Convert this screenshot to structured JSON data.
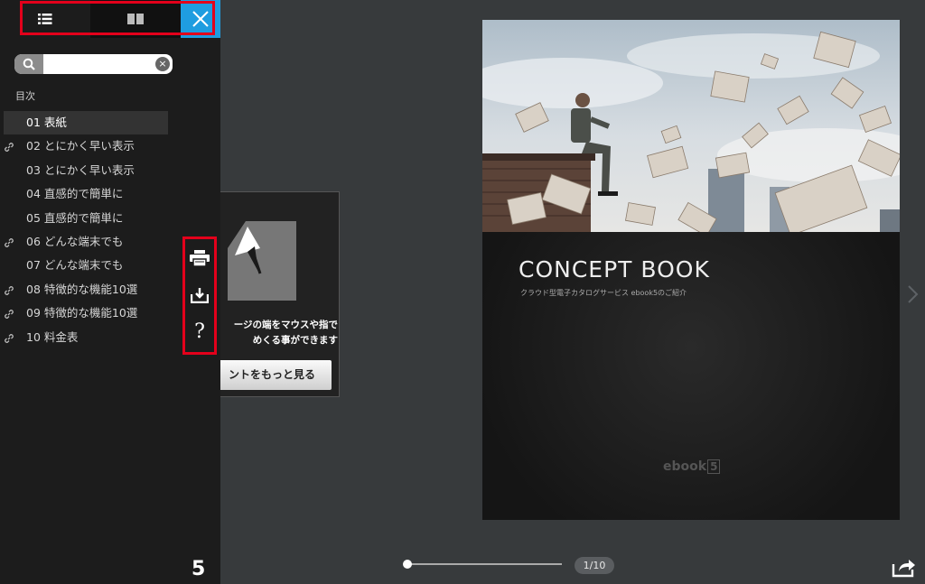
{
  "sidebar": {
    "tabs": [
      {
        "name": "list-icon"
      },
      {
        "name": "book-spread-icon"
      },
      {
        "name": "close-icon"
      }
    ],
    "search": {
      "value": "",
      "placeholder": ""
    },
    "toc_title": "目次",
    "toc_items": [
      {
        "label": "01 表紙",
        "has_link": false,
        "active": true
      },
      {
        "label": "02 とにかく早い表示",
        "has_link": true
      },
      {
        "label": "03 とにかく早い表示",
        "has_link": false
      },
      {
        "label": "04 直感的で簡単に",
        "has_link": false
      },
      {
        "label": "05 直感的で簡単に",
        "has_link": false
      },
      {
        "label": "06 どんな端末でも",
        "has_link": true
      },
      {
        "label": "07 どんな端末でも",
        "has_link": false
      },
      {
        "label": "08 特徴的な機能10選",
        "has_link": true
      },
      {
        "label": "09 特徴的な機能10選",
        "has_link": true
      },
      {
        "label": "10 料金表",
        "has_link": true
      }
    ],
    "tools": [
      "print-icon",
      "download-icon",
      "help-icon"
    ],
    "help_glyph": "?",
    "logo": "5"
  },
  "tutorial": {
    "line1": "ージの端をマウスや指で",
    "line2": "めくる事ができます",
    "button": "ントをもっと見る"
  },
  "book": {
    "title": "CONCEPT BOOK",
    "subtitle": "クラウド型電子カタログサービス ebook5のご紹介",
    "brand": "ebook",
    "brand_num": "5"
  },
  "footer": {
    "progress": 0.0,
    "page_indicator": "1/10"
  },
  "colors": {
    "accent": "#1f9de0",
    "highlight": "#e3001b",
    "sidebar_bg": "#1c1c1c",
    "stage_bg": "#373a3c"
  }
}
